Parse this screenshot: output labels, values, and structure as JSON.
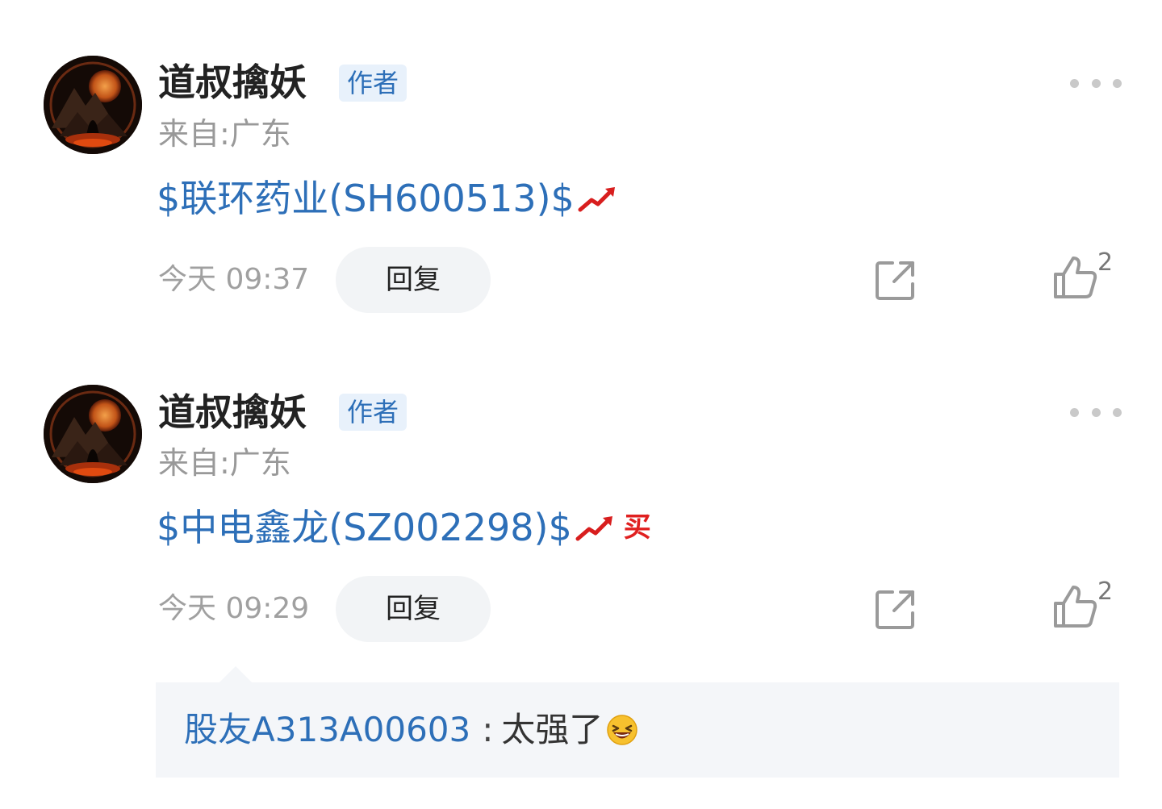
{
  "posts": [
    {
      "username": "道叔擒妖",
      "author_tag": "作者",
      "location": "来自:广东",
      "stock": "$联环药业(SH600513)$",
      "has_buy_badge": false,
      "time": "今天 09:37",
      "reply_label": "回复",
      "like_count": "2"
    },
    {
      "username": "道叔擒妖",
      "author_tag": "作者",
      "location": "来自:广东",
      "stock": "$中电鑫龙(SZ002298)$",
      "buy_badge": "买",
      "has_buy_badge": true,
      "time": "今天 09:29",
      "reply_label": "回复",
      "like_count": "2",
      "reply": {
        "user": "股友A313A00603",
        "colon": ":",
        "text": "太强了"
      }
    }
  ],
  "icons": {
    "trend": "trend-up-icon",
    "emoji": "laughing-emoji-icon",
    "share": "share-icon",
    "like": "thumbs-up-icon",
    "more": "more-icon"
  },
  "colors": {
    "link": "#2d6fb8",
    "badge_bg": "#e8f1fb",
    "reply_bg": "#f4f6f9",
    "buy": "#e02020"
  }
}
